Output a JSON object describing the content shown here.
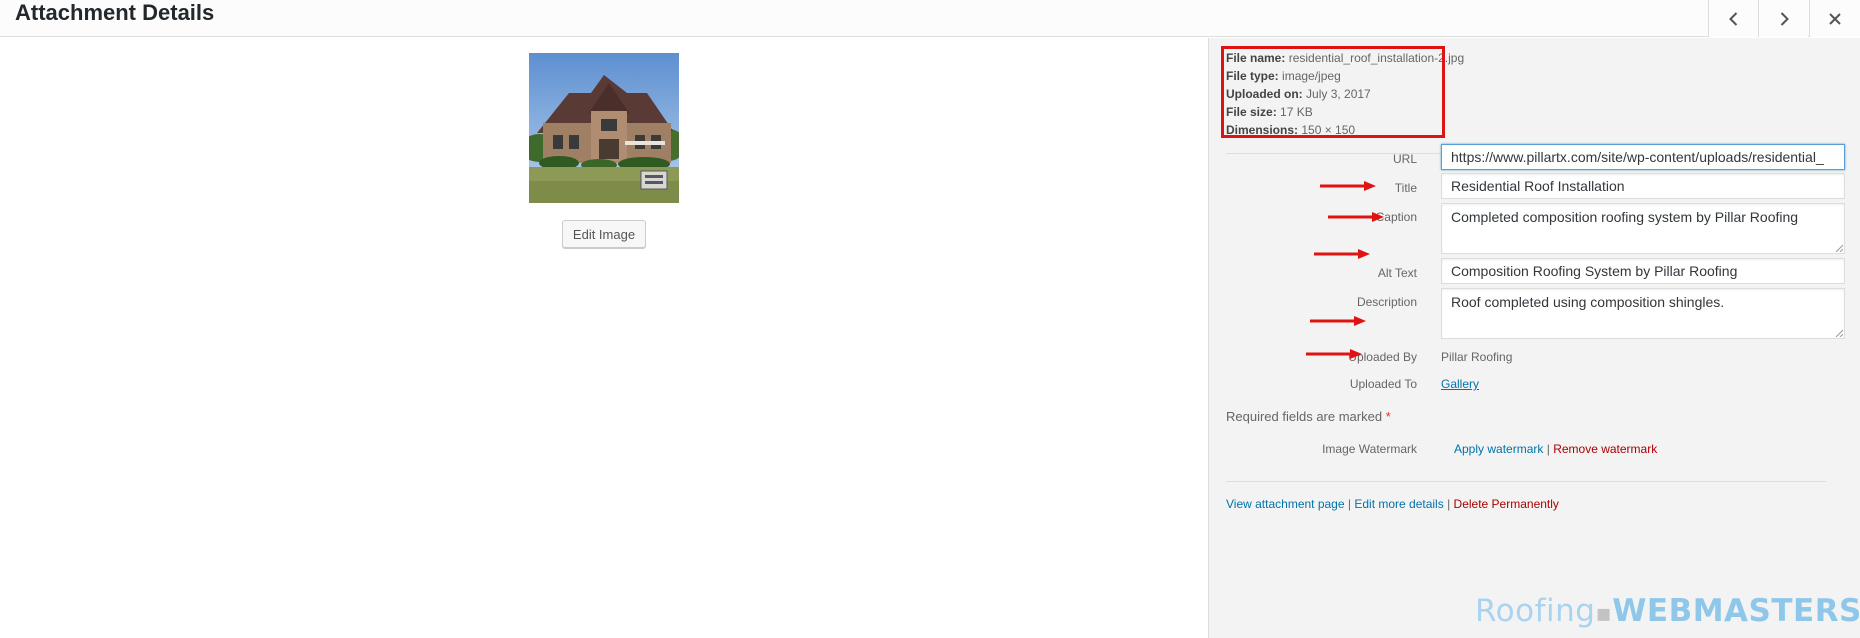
{
  "header": {
    "title": "Attachment Details",
    "prev_icon": "chevron-left-icon",
    "next_icon": "chevron-right-icon",
    "close_icon": "close-icon"
  },
  "left": {
    "edit_image_label": "Edit Image"
  },
  "meta": {
    "file_name_label": "File name:",
    "file_name": "residential_roof_installation-2.jpg",
    "file_type_label": "File type:",
    "file_type": "image/jpeg",
    "uploaded_on_label": "Uploaded on:",
    "uploaded_on": "July 3, 2017",
    "file_size_label": "File size:",
    "file_size": "17 KB",
    "dimensions_label": "Dimensions:",
    "dimensions": "150 × 150"
  },
  "fields": {
    "url_label": "URL",
    "url_value": "https://www.pillartx.com/site/wp-content/uploads/residential_",
    "title_label": "Title",
    "title_value": "Residential Roof Installation",
    "caption_label": "Caption",
    "caption_value": "Completed composition roofing system by Pillar Roofing",
    "alt_label": "Alt Text",
    "alt_value": "Composition Roofing System by Pillar Roofing",
    "description_label": "Description",
    "description_value": "Roof completed using composition shingles.",
    "uploaded_by_label": "Uploaded By",
    "uploaded_by_value": "Pillar Roofing",
    "uploaded_to_label": "Uploaded To",
    "uploaded_to_value": "Gallery"
  },
  "required_note": "Required fields are marked",
  "required_star": "*",
  "watermark": {
    "label": "Image Watermark",
    "apply": "Apply watermark",
    "separator": "|",
    "remove": "Remove watermark"
  },
  "actions": {
    "view": "View attachment page",
    "edit": "Edit more details",
    "delete": "Delete Permanently",
    "separator": "|"
  },
  "brand_watermark": {
    "part1": "Roofing",
    "part2": "WEBMASTERS"
  },
  "colors": {
    "annotation_red": "#e01313",
    "link_blue": "#0073aa",
    "delete_red": "#a00000",
    "focus_blue": "#5b9dd9"
  }
}
